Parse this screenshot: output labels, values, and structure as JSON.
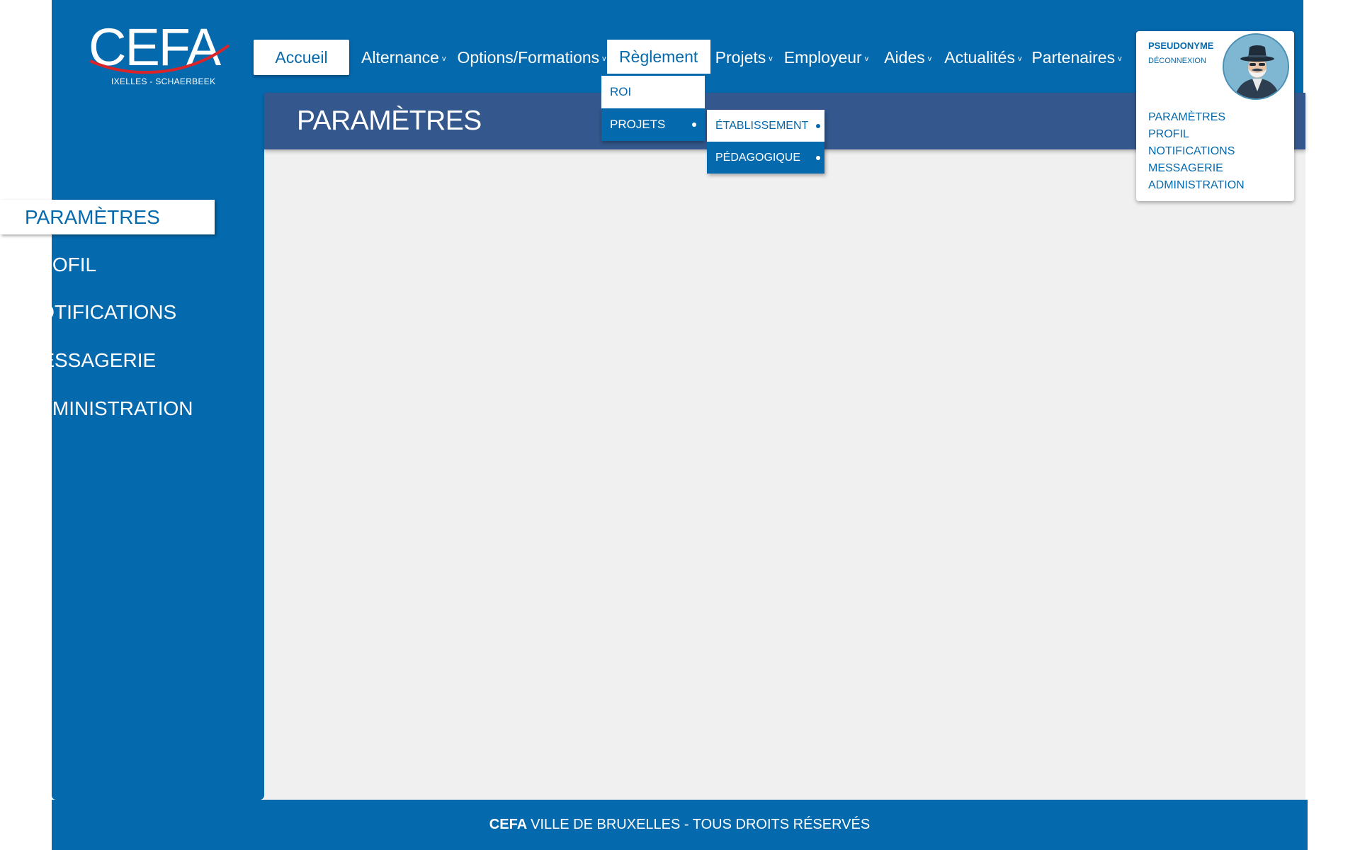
{
  "brand": {
    "logo_text": "CEFA",
    "logo_subtitle": "IXELLES - SCHAERBEEK"
  },
  "nav": {
    "home": "Accueil",
    "items": [
      {
        "label": "Alternance",
        "chevron": "v"
      },
      {
        "label": "Options/Formations",
        "chevron": "v"
      },
      {
        "label": "Règlement"
      },
      {
        "label": "Projets",
        "chevron": "v"
      },
      {
        "label": "Employeur",
        "chevron": "v"
      },
      {
        "label": "Aides",
        "chevron": "v"
      },
      {
        "label": "Actualités",
        "chevron": "v"
      },
      {
        "label": "Partenaires",
        "chevron": "v"
      }
    ]
  },
  "reglement_dropdown": {
    "items": [
      "ROI",
      "PROJETS"
    ]
  },
  "projets_submenu": {
    "items": [
      "ÉTABLISSEMENT",
      "PÉDAGOGIQUE"
    ]
  },
  "page": {
    "title": "PARAMÈTRES"
  },
  "sidebar": {
    "items": [
      "PARAMÈTRES",
      "PROFIL",
      "NOTIFICATIONS",
      "MESSAGERIE",
      "ADMINISTRATION"
    ]
  },
  "user": {
    "name": "PSEUDONYME",
    "logout": "DÉCONNEXION",
    "menu": [
      "PARAMÈTRES",
      "PROFIL",
      "NOTIFICATIONS",
      "MESSAGERIE",
      "ADMINISTRATION"
    ]
  },
  "footer": {
    "brand": "CEFA",
    "text": "VILLE DE BRUXELLES - TOUS DROITS RÉSERVÉS"
  },
  "colors": {
    "primary": "#0569ad",
    "title_bar": "#34588d",
    "content_bg": "#f0f0f0"
  }
}
